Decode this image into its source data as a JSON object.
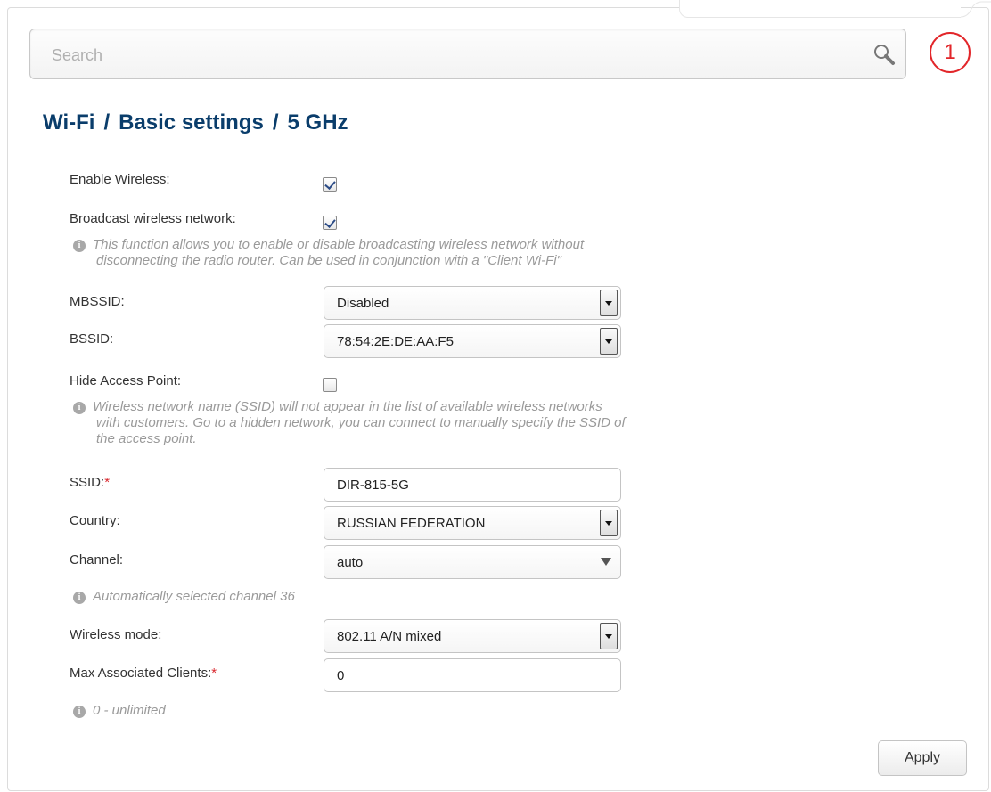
{
  "search": {
    "placeholder": "Search"
  },
  "badge": {
    "number": "1"
  },
  "breadcrumb": {
    "part1": "Wi-Fi",
    "part2": "Basic settings",
    "part3": "5 GHz",
    "separator": "/"
  },
  "form": {
    "enable_wireless": {
      "label": "Enable Wireless:",
      "checked": true
    },
    "broadcast": {
      "label": "Broadcast wireless network:",
      "checked": true,
      "hint_line1": "This function allows you to enable or disable broadcasting wireless network without",
      "hint_line2": "disconnecting the radio router. Can be used in conjunction with a \"Client Wi-Fi\""
    },
    "mbssid": {
      "label": "MBSSID:",
      "value": "Disabled"
    },
    "bssid": {
      "label": "BSSID:",
      "value": "78:54:2E:DE:AA:F5"
    },
    "hide_ap": {
      "label": "Hide Access Point:",
      "checked": false,
      "hint_line1": "Wireless network name (SSID) will not appear in the list of available wireless networks",
      "hint_line2": "with customers. Go to a hidden network, you can connect to manually specify the SSID of",
      "hint_line3": "the access point."
    },
    "ssid": {
      "label": "SSID:",
      "required_mark": "*",
      "value": "DIR-815-5G"
    },
    "country": {
      "label": "Country:",
      "value": "RUSSIAN FEDERATION"
    },
    "channel": {
      "label": "Channel:",
      "value": "auto",
      "hint": "Automatically selected channel 36"
    },
    "wireless_mode": {
      "label": "Wireless mode:",
      "value": "802.11 A/N mixed"
    },
    "max_clients": {
      "label": "Max Associated Clients:",
      "required_mark": "*",
      "value": "0",
      "hint": "0 - unlimited"
    }
  },
  "actions": {
    "apply_label": "Apply"
  },
  "colors": {
    "title": "#0a3d6b",
    "badge": "#e2262a",
    "hint": "#9a9a9a",
    "required": "#d9272e"
  },
  "icons": {
    "search": "magnifier-icon",
    "info": "info-icon"
  }
}
